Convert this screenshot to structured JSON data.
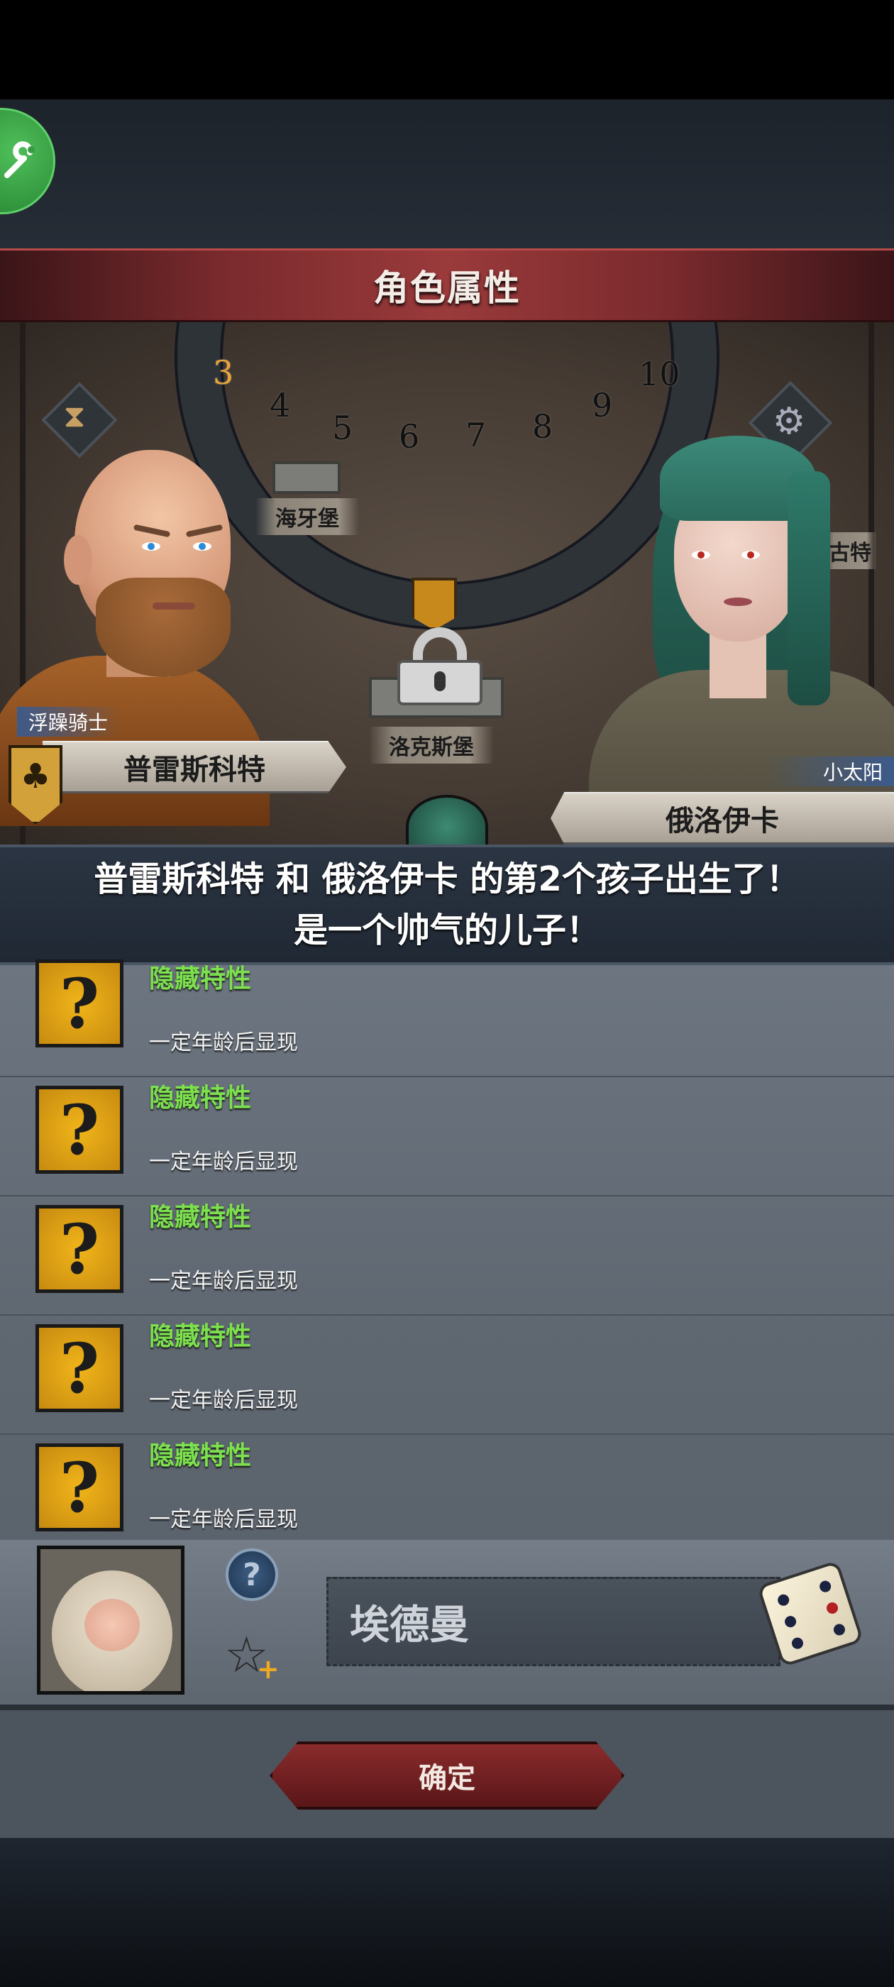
{
  "header": {
    "title": "角色属性"
  },
  "dial": {
    "numbers": [
      "3",
      "4",
      "5",
      "6",
      "7",
      "8",
      "9",
      "10"
    ]
  },
  "map": {
    "castle_top": "海牙堡",
    "castle_center": "洛克斯堡",
    "castle_right_partial": "古特"
  },
  "father": {
    "title": "浮躁骑士",
    "name": "普雷斯科特"
  },
  "mother": {
    "title": "小太阳",
    "name": "俄洛伊卡"
  },
  "announcement": {
    "line1": "普雷斯科特 和 俄洛伊卡 的第2个孩子出生了！",
    "line2": "是一个帅气的儿子！"
  },
  "traits": [
    {
      "icon": "?",
      "name": "隐藏特性",
      "desc": "一定年龄后显现"
    },
    {
      "icon": "?",
      "name": "隐藏特性",
      "desc": "一定年龄后显现"
    },
    {
      "icon": "?",
      "name": "隐藏特性",
      "desc": "一定年龄后显现"
    },
    {
      "icon": "?",
      "name": "隐藏特性",
      "desc": "一定年龄后显现"
    },
    {
      "icon": "?",
      "name": "隐藏特性",
      "desc": "一定年龄后显现"
    }
  ],
  "child": {
    "name": "埃德曼",
    "hint_icon": "?"
  },
  "actions": {
    "confirm": "确定"
  },
  "colors": {
    "banner": "#9a3a3b",
    "trait_name": "#7de04e",
    "trait_icon": "#f0b51a",
    "button": "#8a2b2c"
  },
  "icons": [
    "wrench-icon",
    "hourglass-icon",
    "gear-icon",
    "lock-icon",
    "question-icon",
    "star-plus-icon",
    "dice-icon"
  ]
}
